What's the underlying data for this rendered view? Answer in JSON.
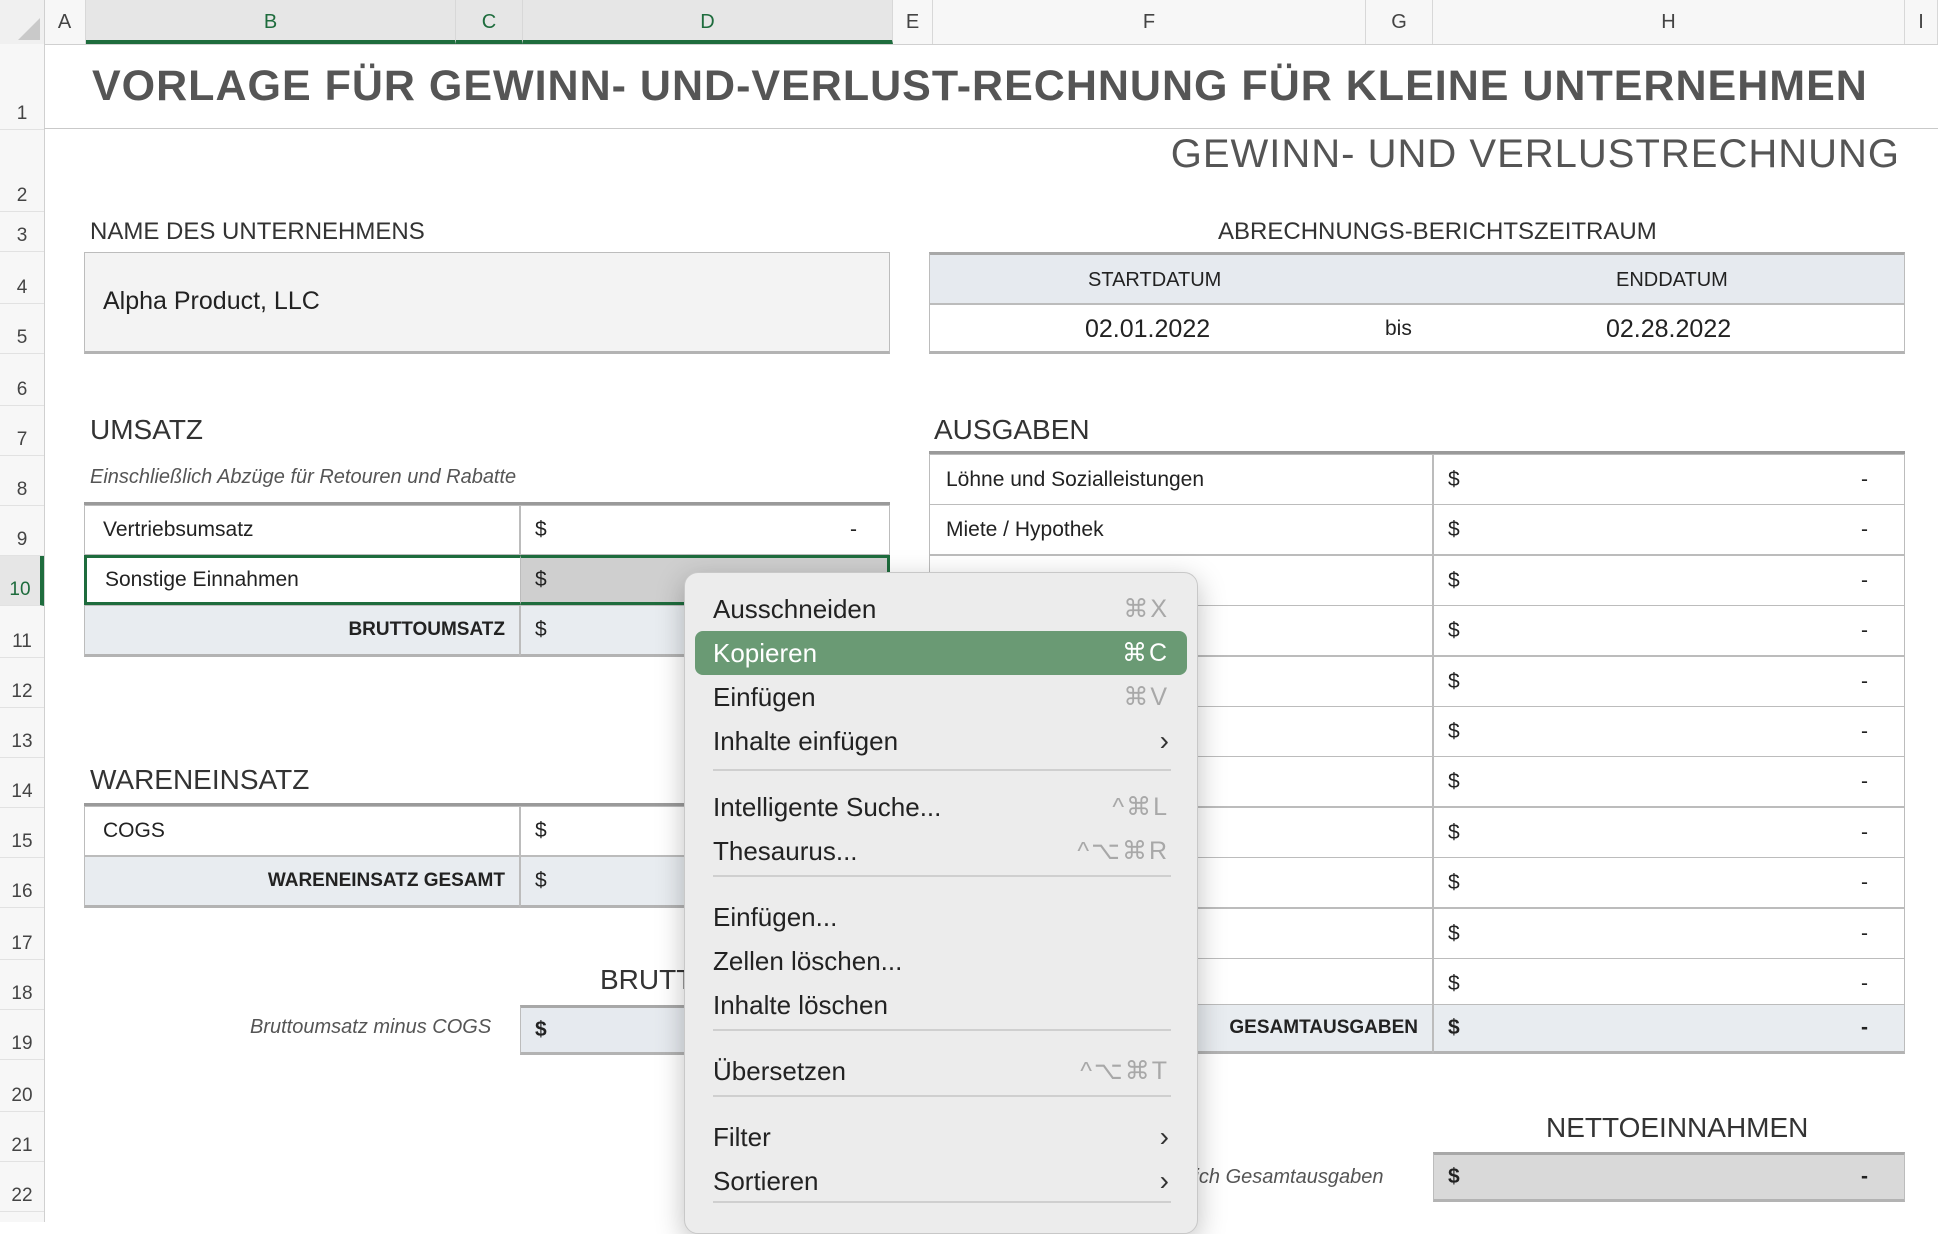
{
  "columns": [
    "A",
    "B",
    "C",
    "D",
    "E",
    "F",
    "G",
    "H",
    "I"
  ],
  "rows": [
    "1",
    "2",
    "3",
    "4",
    "5",
    "6",
    "7",
    "8",
    "9",
    "10",
    "11",
    "12",
    "13",
    "14",
    "15",
    "16",
    "17",
    "18",
    "19",
    "20",
    "21",
    "22"
  ],
  "sheet": {
    "title": "VORLAGE FÜR GEWINN- UND-VERLUST-RECHNUNG FÜR KLEINE UNTERNEHMEN",
    "subtitle": "GEWINN- UND VERLUSTRECHNUNG",
    "company_label": "NAME DES UNTERNEHMENS",
    "company_value": "Alpha Product, LLC",
    "period_label": "ABRECHNUNGS-BERICHTSZEITRAUM",
    "start_label": "STARTDATUM",
    "end_label": "ENDDATUM",
    "start_value": "02.01.2022",
    "between": "bis",
    "end_value": "02.28.2022",
    "revenue": {
      "heading": "UMSATZ",
      "note": "Einschließlich Abzüge für Retouren und Rabatte",
      "rows": [
        {
          "label": "Vertriebsumsatz",
          "currency": "$",
          "value": "-"
        },
        {
          "label": "Sonstige Einnahmen",
          "currency": "$",
          "value": ""
        }
      ],
      "total_label": "BRUTTOUMSATZ",
      "total_currency": "$"
    },
    "cogs": {
      "heading": "WARENEINSATZ",
      "rows": [
        {
          "label": "COGS",
          "currency": "$"
        }
      ],
      "total_label": "WARENEINSATZ GESAMT",
      "total_currency": "$"
    },
    "gross": {
      "heading": "BRUTTO",
      "note": "Bruttoumsatz minus COGS",
      "currency": "$"
    },
    "expenses": {
      "heading": "AUSGABEN",
      "rows": [
        {
          "label": "Löhne und Sozialleistungen",
          "currency": "$",
          "value": "-"
        },
        {
          "label": "Miete / Hypothek",
          "currency": "$",
          "value": "-"
        },
        {
          "label": "",
          "currency": "$",
          "value": "-"
        },
        {
          "label": "",
          "currency": "$",
          "value": "-"
        },
        {
          "label": "",
          "currency": "$",
          "value": "-"
        },
        {
          "label": "",
          "currency": "$",
          "value": "-"
        },
        {
          "label": "",
          "currency": "$",
          "value": "-"
        },
        {
          "label": "",
          "currency": "$",
          "value": "-"
        },
        {
          "label": "",
          "currency": "$",
          "value": "-"
        },
        {
          "label": "",
          "currency": "$",
          "value": "-"
        },
        {
          "label": "",
          "currency": "$",
          "value": "-"
        }
      ],
      "total_label": "GESAMTAUSGABEN",
      "total_currency": "$",
      "total_value": "-"
    },
    "net": {
      "heading": "NETTOEINNAHMEN",
      "note": "lich Gesamtausgaben",
      "currency": "$",
      "value": "-"
    }
  },
  "menu": {
    "items": [
      {
        "label": "Ausschneiden",
        "shortcut": "⌘X",
        "submenu": false,
        "highlighted": false
      },
      {
        "label": "Kopieren",
        "shortcut": "⌘C",
        "submenu": false,
        "highlighted": true
      },
      {
        "label": "Einfügen",
        "shortcut": "⌘V",
        "submenu": false,
        "highlighted": false
      },
      {
        "label": "Inhalte einfügen",
        "shortcut": "",
        "submenu": true,
        "highlighted": false
      },
      {
        "label": "Intelligente Suche...",
        "shortcut": "^⌘L",
        "submenu": false,
        "highlighted": false
      },
      {
        "label": "Thesaurus...",
        "shortcut": "^⌥⌘R",
        "submenu": false,
        "highlighted": false
      },
      {
        "label": "Einfügen...",
        "shortcut": "",
        "submenu": false,
        "highlighted": false
      },
      {
        "label": "Zellen löschen...",
        "shortcut": "",
        "submenu": false,
        "highlighted": false
      },
      {
        "label": "Inhalte löschen",
        "shortcut": "",
        "submenu": false,
        "highlighted": false
      },
      {
        "label": "Übersetzen",
        "shortcut": "^⌥⌘T",
        "submenu": false,
        "highlighted": false
      },
      {
        "label": "Filter",
        "shortcut": "",
        "submenu": true,
        "highlighted": false
      },
      {
        "label": "Sortieren",
        "shortcut": "",
        "submenu": true,
        "highlighted": false
      }
    ]
  },
  "colors": {
    "accent": "#1e6c3d",
    "menu_highlight": "#6a9a74",
    "header_fill": "#e6eaef"
  }
}
